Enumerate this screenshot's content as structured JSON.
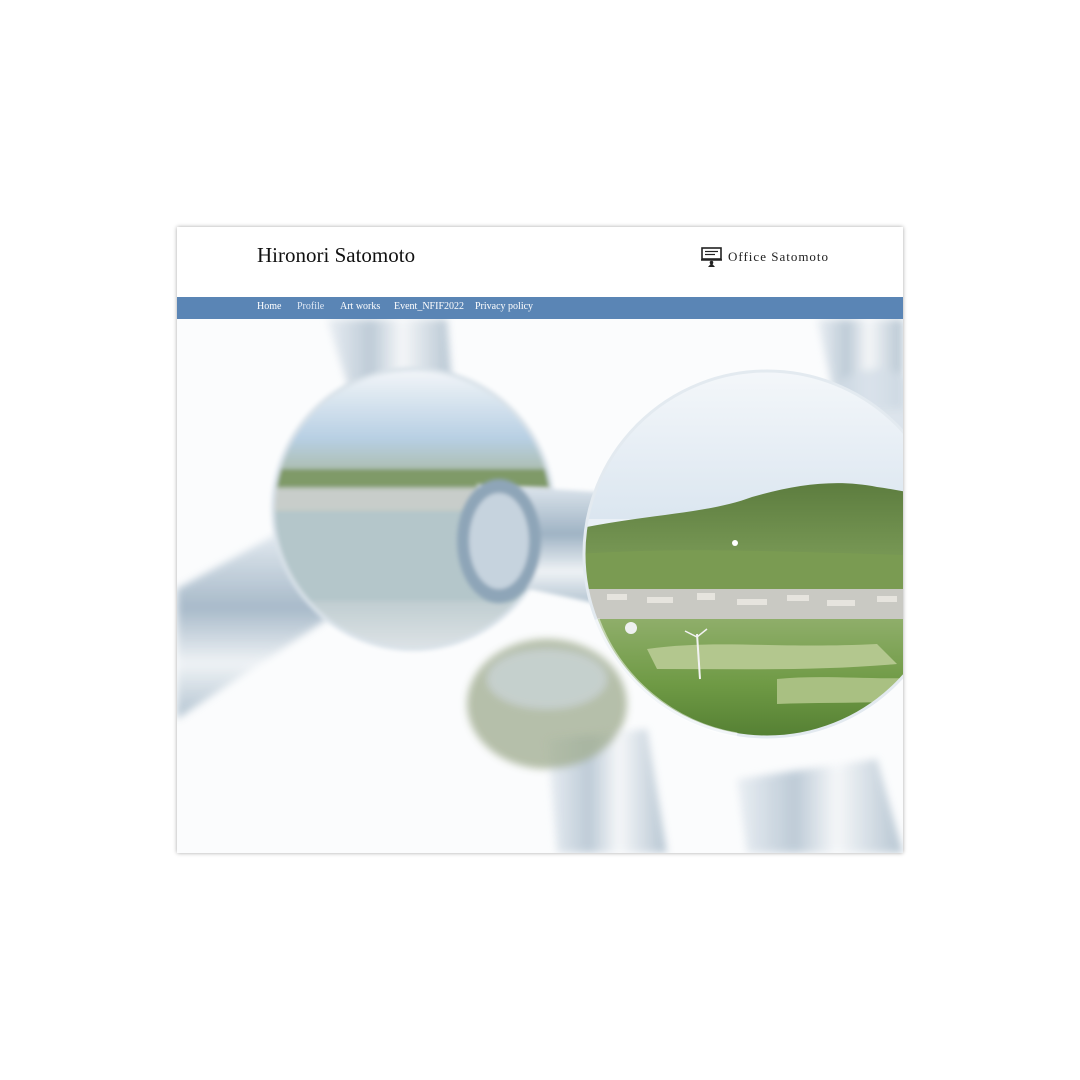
{
  "header": {
    "site_title": "Hironori Satomoto",
    "office_name": "Office Satomoto",
    "office_icon": "presentation-board-icon"
  },
  "nav": {
    "items": [
      {
        "label": "Home"
      },
      {
        "label": "Profile"
      },
      {
        "label": "Art works"
      },
      {
        "label": "Event_NFIF2022"
      },
      {
        "label": "Privacy policy"
      }
    ]
  },
  "hero": {
    "image": "glass-sphere-sculpture-landscape-photo"
  },
  "colors": {
    "nav_background": "#5a85b5",
    "nav_text": "#ffffff",
    "title_text": "#111111"
  }
}
